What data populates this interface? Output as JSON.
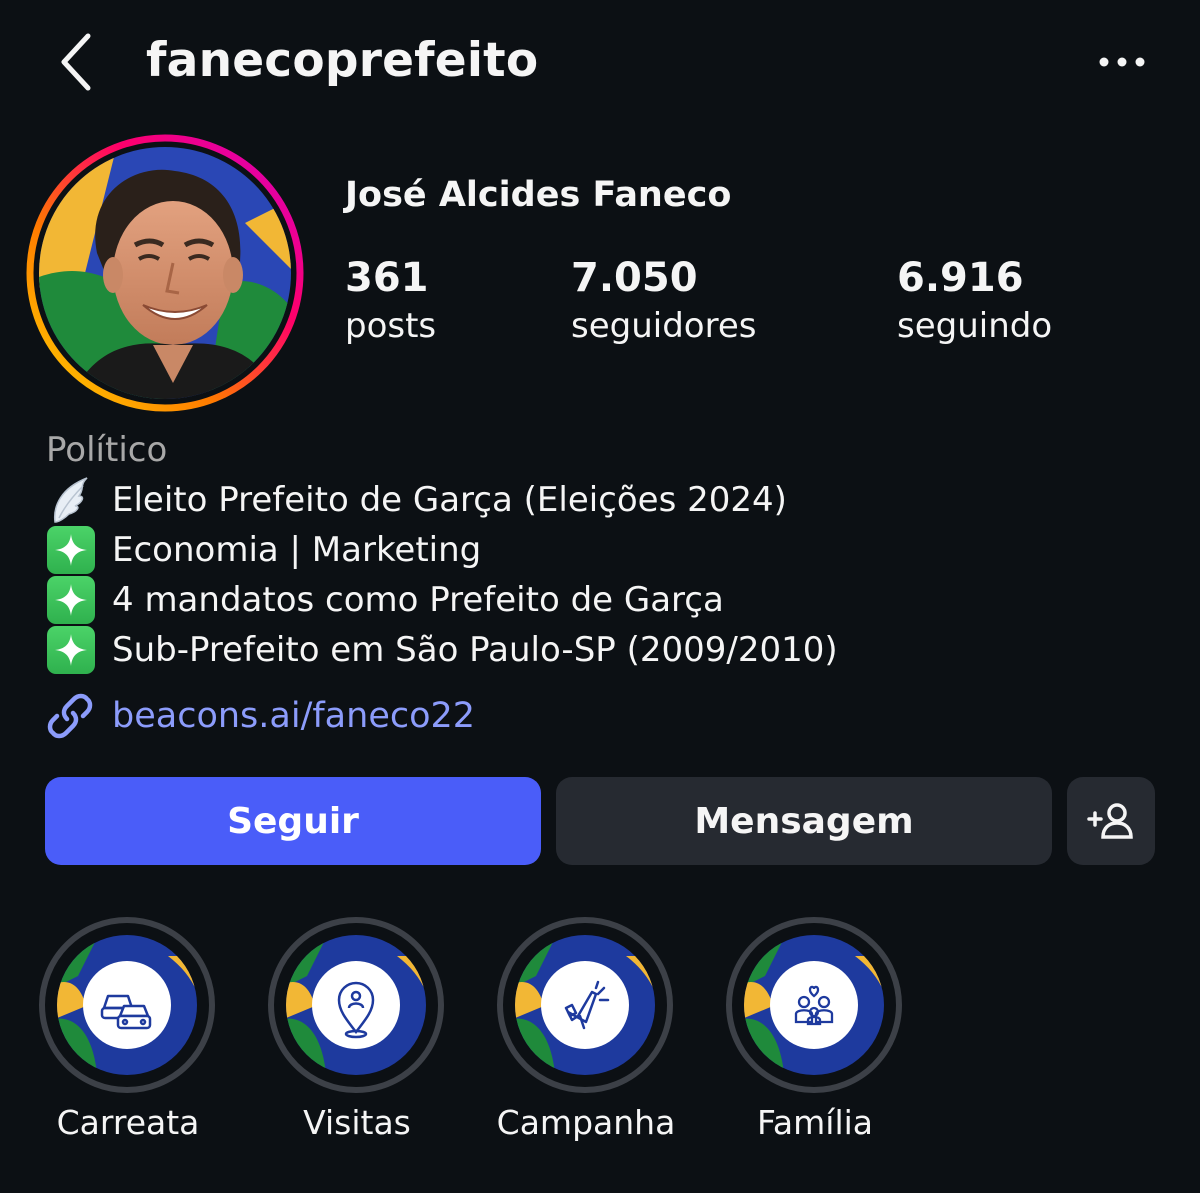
{
  "header": {
    "username": "fanecoprefeito",
    "back_icon": "chevron-left-icon",
    "more_icon": "more-horizontal-icon"
  },
  "profile": {
    "display_name": "José Alcides Faneco",
    "stats": {
      "posts": {
        "value": "361",
        "label": "posts"
      },
      "followers": {
        "value": "7.050",
        "label": "seguidores"
      },
      "following": {
        "value": "6.916",
        "label": "seguindo"
      }
    },
    "category": "Político",
    "bio": [
      {
        "icon": "wing-emoji-icon",
        "text": "Eleito Prefeito de Garça (Eleições 2024)"
      },
      {
        "icon": "sparkles-emoji-icon",
        "text": "Economia | Marketing"
      },
      {
        "icon": "sparkles-emoji-icon",
        "text": "4 mandatos como Prefeito de Garça"
      },
      {
        "icon": "sparkles-emoji-icon",
        "text": "Sub-Prefeito em São Paulo-SP (2009/2010)"
      }
    ],
    "link": "beacons.ai/faneco22"
  },
  "actions": {
    "follow_label": "Seguir",
    "message_label": "Mensagem",
    "add_icon": "add-person-icon"
  },
  "highlights": [
    {
      "label": "Carreata",
      "icon": "cars-icon"
    },
    {
      "label": "Visitas",
      "icon": "location-person-icon"
    },
    {
      "label": "Campanha",
      "icon": "megaphone-icon"
    },
    {
      "label": "Família",
      "icon": "family-icon"
    }
  ],
  "colors": {
    "background": "#0c1014",
    "follow_button": "#4a5df9",
    "secondary_button": "#262a31",
    "link": "#8c9cfb",
    "muted_text": "#a8a8a8",
    "brand_green": "#1f8a3b",
    "brand_yellow": "#f2b735",
    "brand_blue": "#1e3a9e"
  }
}
